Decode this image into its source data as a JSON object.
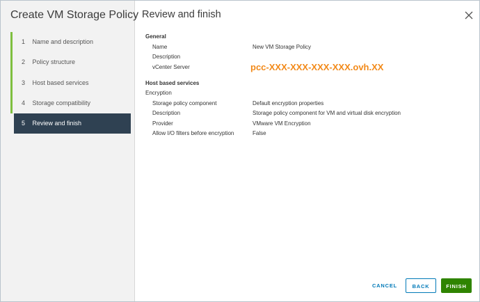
{
  "wizard": {
    "title": "Create VM Storage Policy",
    "steps": [
      {
        "num": "1",
        "label": "Name and description"
      },
      {
        "num": "2",
        "label": "Policy structure"
      },
      {
        "num": "3",
        "label": "Host based services"
      },
      {
        "num": "4",
        "label": "Storage compatibility"
      },
      {
        "num": "5",
        "label": "Review and finish"
      }
    ]
  },
  "page": {
    "title": "Review and finish",
    "close_icon": "close-icon"
  },
  "general": {
    "heading": "General",
    "name_label": "Name",
    "name_value": "New VM Storage Policy",
    "description_label": "Description",
    "vcenter_label": "vCenter Server",
    "vcenter_value": "pcc-XXX-XXX-XXX-XXX.ovh.XX"
  },
  "host_services": {
    "heading": "Host based services",
    "category": "Encryption",
    "rows": [
      {
        "label": "Storage policy component",
        "value": "Default encryption properties"
      },
      {
        "label": "Description",
        "value": "Storage policy component for VM and virtual disk encryption"
      },
      {
        "label": "Provider",
        "value": "VMware VM Encryption"
      },
      {
        "label": "Allow I/O filters before encryption",
        "value": "False"
      }
    ]
  },
  "footer": {
    "cancel": "CANCEL",
    "back": "BACK",
    "finish": "FINISH"
  },
  "colors": {
    "step_accent": "#7fbf3f",
    "active_step": "#2f4152",
    "link_blue": "#0079b8",
    "finish_green": "#2f8400",
    "vcenter_orange": "#f28a1a"
  }
}
